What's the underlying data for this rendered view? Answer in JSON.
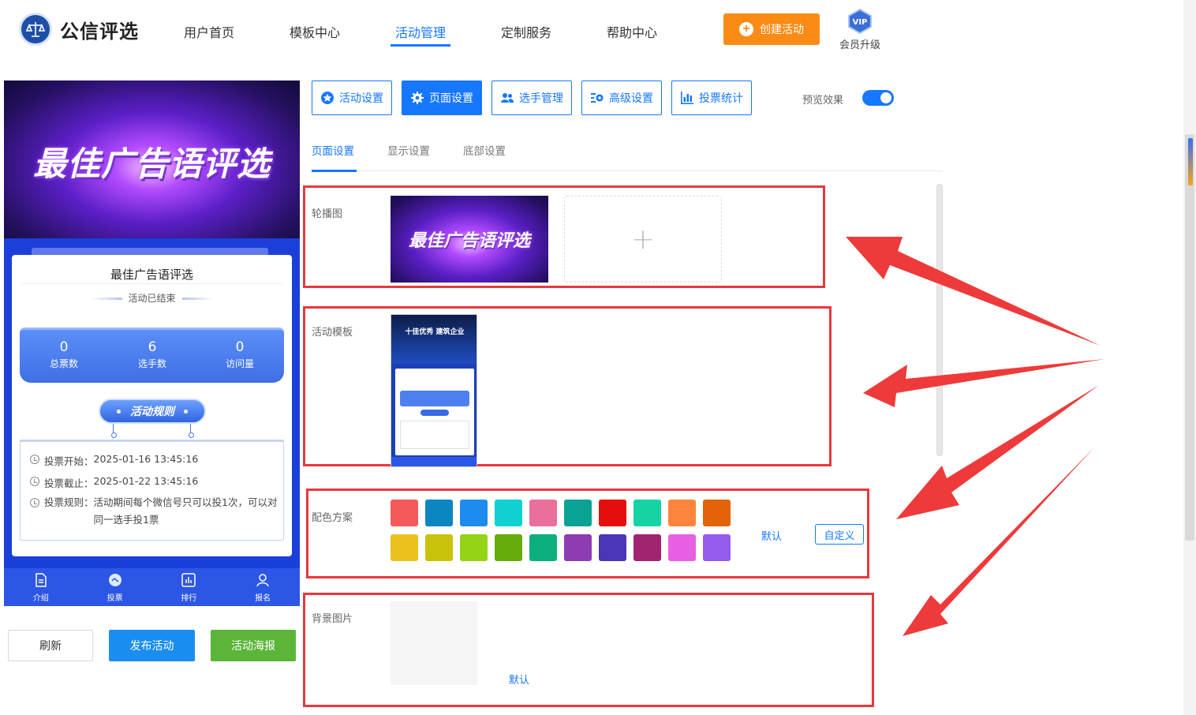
{
  "brand": {
    "name": "公信评选"
  },
  "nav": {
    "items": [
      {
        "label": "用户首页"
      },
      {
        "label": "模板中心"
      },
      {
        "label": "活动管理"
      },
      {
        "label": "定制服务"
      },
      {
        "label": "帮助中心"
      }
    ],
    "active_index": 2,
    "create_label": "创建活动",
    "vip_badge": "VIP",
    "vip_label": "会员升级"
  },
  "preview": {
    "banner_title": "最佳广告语评选",
    "activity_title": "最佳广告语评选",
    "status": "活动已结束",
    "stats": [
      {
        "value": "0",
        "label": "总票数"
      },
      {
        "value": "6",
        "label": "选手数"
      },
      {
        "value": "0",
        "label": "访问量"
      }
    ],
    "rules_button": "活动规则",
    "rules": [
      {
        "key": "投票开始：",
        "value": "2025-01-16 13:45:16"
      },
      {
        "key": "投票截止：",
        "value": "2025-01-22 13:45:16"
      },
      {
        "key": "投票规则：",
        "value": "活动期间每个微信号只可以投1次，可以对同一选手投1票"
      }
    ],
    "tabbar": [
      {
        "label": "介绍",
        "icon": "document-icon"
      },
      {
        "label": "投票",
        "icon": "vote-icon"
      },
      {
        "label": "排行",
        "icon": "chart-icon"
      },
      {
        "label": "报名",
        "icon": "user-icon"
      }
    ]
  },
  "actions": {
    "refresh": "刷新",
    "publish": "发布活动",
    "poster": "活动海报"
  },
  "settings": {
    "buttons": [
      {
        "label": "活动设置",
        "icon": "star-icon"
      },
      {
        "label": "页面设置",
        "icon": "gear-icon"
      },
      {
        "label": "选手管理",
        "icon": "users-icon"
      },
      {
        "label": "高级设置",
        "icon": "advanced-settings-icon"
      },
      {
        "label": "投票统计",
        "icon": "bar-chart-icon"
      }
    ],
    "active_index": 1,
    "preview_label": "预览效果",
    "preview_on": true,
    "subtabs": [
      {
        "label": "页面设置"
      },
      {
        "label": "显示设置"
      },
      {
        "label": "底部设置"
      }
    ],
    "active_subtab": 0,
    "sections": {
      "carousel": {
        "label": "轮播图",
        "image_text": "最佳广告语评选"
      },
      "template": {
        "label": "活动模板",
        "template_title": "十佳优秀 建筑企业"
      },
      "color_scheme": {
        "label": "配色方案",
        "colors": [
          "#f45a5a",
          "#0b86c0",
          "#1d8bf0",
          "#10d0d2",
          "#ea6f9a",
          "#0aa294",
          "#e50d0d",
          "#16d3a4",
          "#fd843d",
          "#e26308",
          "#ecc11c",
          "#c8c20a",
          "#94d315",
          "#66ac0a",
          "#0baf7e",
          "#8d3cb1",
          "#4a36b6",
          "#a2246f",
          "#e85fe2",
          "#945cec"
        ],
        "default_label": "默认",
        "custom_label": "自定义"
      },
      "background": {
        "label": "背景图片",
        "default_label": "默认"
      }
    }
  }
}
